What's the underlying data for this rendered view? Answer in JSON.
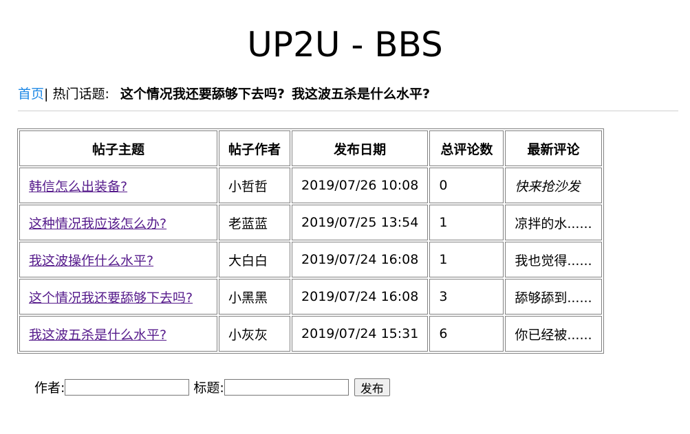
{
  "site": {
    "title": "UP2U - BBS"
  },
  "nav": {
    "home_label": "首页",
    "separator": "|",
    "hot_label": " 热门话题: ",
    "hot_topics": [
      "这个情况我还要舔够下去吗?",
      "我这波五杀是什么水平?"
    ]
  },
  "table": {
    "headers": {
      "topic": "帖子主题",
      "author": "帖子作者",
      "date": "发布日期",
      "count": "总评论数",
      "latest": "最新评论"
    },
    "rows": [
      {
        "topic": "韩信怎么出装备? ",
        "author": "小哲哲",
        "date": "2019/07/26 10:08",
        "count": "0",
        "latest": "快来抢沙发"
      },
      {
        "topic": "这种情况我应该怎么办? ",
        "author": "老蓝蓝",
        "date": "2019/07/25 13:54",
        "count": "1",
        "latest": "凉拌的水......"
      },
      {
        "topic": "我这波操作什么水平? ",
        "author": "大白白",
        "date": "2019/07/24 16:08",
        "count": "1",
        "latest": "我也觉得......"
      },
      {
        "topic": "这个情况我还要舔够下去吗? ",
        "author": "小黑黑",
        "date": "2019/07/24 16:08",
        "count": "3",
        "latest": "舔够舔到......"
      },
      {
        "topic": "我这波五杀是什么水平? ",
        "author": "小灰灰",
        "date": "2019/07/24 15:31",
        "count": "6",
        "latest": "你已经被......"
      }
    ]
  },
  "form": {
    "author_label": "作者:",
    "author_value": "",
    "title_label": "标题:",
    "title_value": "",
    "submit_label": "发布"
  }
}
